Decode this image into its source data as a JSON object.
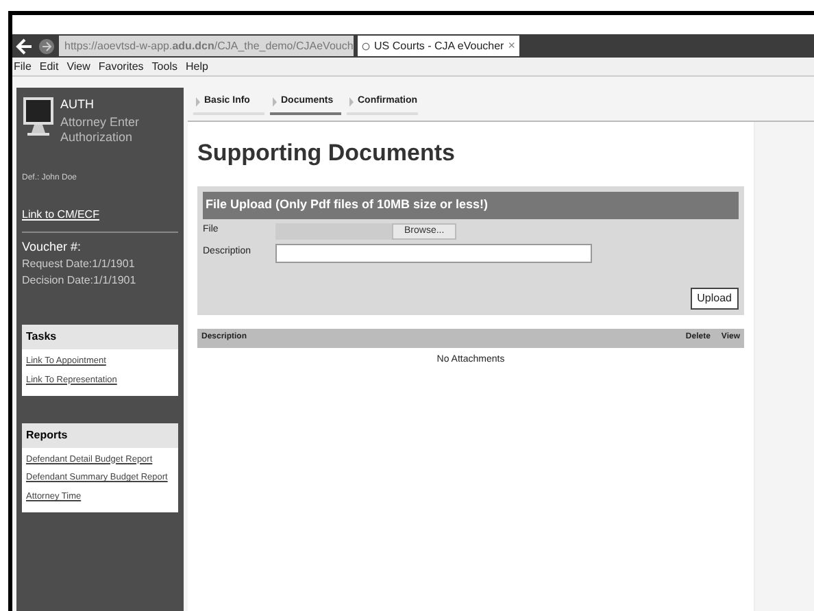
{
  "browser": {
    "url": "https://aoevtsd-w-app.**adu.dcn**/CJA_the_demo/CJAeVouch",
    "tab_title": "US Courts - CJA eVoucher",
    "tab_close": "×"
  },
  "menu": [
    "File",
    "Edit",
    "View",
    "Favorites",
    "Tools",
    "Help"
  ],
  "sidebar": {
    "code": "AUTH",
    "title": "Attorney Enter Authorization",
    "defendant": "Def.: John Doe",
    "cmecf_link": "Link to CM/ECF",
    "voucher_label": "Voucher #:",
    "request_date": "Request Date:1/1/1901",
    "decision_date": "Decision Date:1/1/1901",
    "panels": [
      {
        "title": "Tasks",
        "links": [
          "Link To Appointment",
          "Link To Representation"
        ]
      },
      {
        "title": "Reports",
        "links": [
          "Defendant Detail Budget Report",
          "Defendant Summary Budget Report",
          "Attorney Time"
        ]
      }
    ]
  },
  "tabs": [
    {
      "label": "Basic Info",
      "selected": false
    },
    {
      "label": "Documents",
      "selected": true
    },
    {
      "label": "Confirmation",
      "selected": false
    }
  ],
  "heading": "Supporting Documents",
  "upload": {
    "title": "File Upload (Only Pdf files of 10MB size or less!)",
    "file_label": "File",
    "browse": "Browse...",
    "description_label": "Description",
    "upload_button": "Upload"
  },
  "attachments": {
    "columns": [
      "Description",
      "Delete",
      "View"
    ],
    "empty": "No Attachments"
  }
}
